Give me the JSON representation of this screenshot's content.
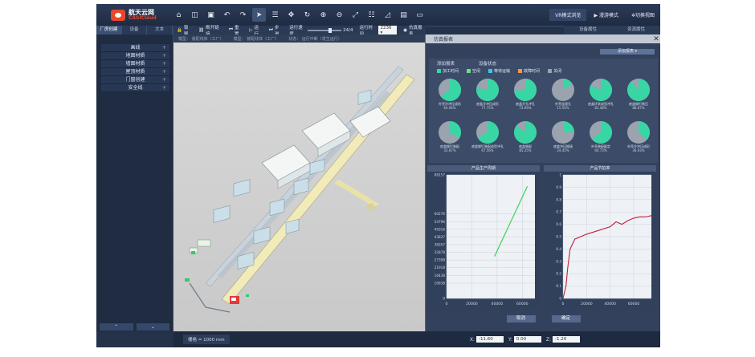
{
  "logo": {
    "name": "航天云网",
    "sub": "CASICloud"
  },
  "toolbar": {
    "icons": [
      "home-icon",
      "cube-icon",
      "save-icon",
      "undo-icon",
      "redo-icon",
      "cursor-icon",
      "list-icon",
      "move-icon",
      "rotate-icon",
      "zoom-in-icon",
      "zoom-out-icon",
      "fit-icon",
      "align-icon",
      "measure-icon",
      "layers-icon",
      "screen-icon"
    ],
    "vr_mode": "VR模式浏览",
    "roam_mode": "▶ 漫游模式",
    "switch_view": "✲切换视图"
  },
  "tabs_right": {
    "device_props": "设备属性",
    "resource_props": "资源属性"
  },
  "left_panel": {
    "tabs": [
      "厂房创建",
      "设备",
      "文本"
    ],
    "items": [
      "画线",
      "地面材质",
      "墙面材质",
      "屋顶材质",
      "门窗创建",
      "安全线"
    ],
    "nav_up": "⌃",
    "nav_down": "⌄"
  },
  "opbar": {
    "lock": "锁屏",
    "link": "断开链接",
    "reset": "重置",
    "run": "运行",
    "step": "步进",
    "speed_label": "运行速度",
    "speed_value": "24/4",
    "run_time_label": "运行时间",
    "run_time_value": "2236",
    "sim_report": "仿真报表",
    "speed_fraction": 0.62
  },
  "info": {
    "line1": "模型：  装配线体（工厂）",
    "line2": "模型：  装配线体（工厂）",
    "line3": "状态：  运行中断（发生运行）"
  },
  "status": {
    "grid": "栅格 = 1000 mm",
    "x_label": "X:",
    "x_value": "-11.60",
    "y_label": "Y:",
    "y_value": "0.00",
    "z_label": "Z:",
    "z_value": "-1.20"
  },
  "dialog": {
    "title": "仿真报表",
    "add_report": "添加报表",
    "sections": [
      "添加报表",
      "设备状态"
    ],
    "legend": [
      {
        "label": "加工时间",
        "color": "#38d6a4"
      },
      {
        "label": "空闲",
        "color": "#6fdc8c"
      },
      {
        "label": "等待运输",
        "color": "#3fc3e6"
      },
      {
        "label": "故障时间",
        "color": "#f09a4a"
      },
      {
        "label": "关闭",
        "color": "#9aa3ae"
      }
    ],
    "pies": [
      {
        "label": "外壳冷冲压成形",
        "pct": "64.94%",
        "value": 0.6494
      },
      {
        "label": "底盖冷冲压成形",
        "pct": "77.75%",
        "value": 0.7775
      },
      {
        "label": "底盖开孔冲孔",
        "pct": "73.69%",
        "value": 0.7369
      },
      {
        "label": "外壳连接孔",
        "pct": "15.50%",
        "value": 0.155
      },
      {
        "label": "底盖环状成型冲孔",
        "pct": "81.48%",
        "value": 0.8148
      },
      {
        "label": "底盖铆钉装压",
        "pct": "88.87%",
        "value": 0.8887
      },
      {
        "label": "底盖铆钉装配",
        "pct": "33.87%",
        "value": 0.3387
      },
      {
        "label": "底盖铆钉装配成型冲孔",
        "pct": "67.56%",
        "value": 0.6756
      },
      {
        "label": "底盖装配",
        "pct": "85.25%",
        "value": 0.8525
      },
      {
        "label": "底盖冲压铆接",
        "pct": "24.45%",
        "value": 0.2445
      },
      {
        "label": "外壳装配配定",
        "pct": "64.73%",
        "value": 0.6473
      },
      {
        "label": "外壳冷冲压成形",
        "pct": "36.93%",
        "value": 0.3693
      }
    ],
    "cancel": "取消",
    "confirm": "确定"
  },
  "chart_data": [
    {
      "type": "line",
      "title": "产品生产周期",
      "x": [
        38000,
        64000
      ],
      "series": [
        {
          "values": [
            30000,
            80000
          ]
        }
      ],
      "ylim": [
        0,
        88157
      ],
      "xlim": [
        0,
        70000
      ],
      "yticks": [
        0,
        10938,
        16438,
        21918,
        27398,
        32878,
        38357,
        43837,
        49316,
        54796,
        60276,
        88157
      ],
      "xticks": [
        0,
        20000,
        40000,
        60000
      ],
      "color": "#2ed14a"
    },
    {
      "type": "line",
      "title": "产品节拍率",
      "x": [
        0,
        2500,
        4000,
        6000,
        10000,
        20000,
        30000,
        40000,
        45000,
        50000,
        55000,
        60000,
        65000,
        70000,
        75000
      ],
      "series": [
        {
          "values": [
            0.0,
            0.1,
            0.25,
            0.4,
            0.48,
            0.52,
            0.55,
            0.58,
            0.62,
            0.6,
            0.63,
            0.65,
            0.66,
            0.66,
            0.67
          ]
        }
      ],
      "ylim": [
        0,
        1.0
      ],
      "xlim": [
        0,
        75000
      ],
      "yticks": [
        0,
        0.1,
        0.2,
        0.3,
        0.4,
        0.5,
        0.6,
        0.7,
        0.8,
        0.9,
        1.0
      ],
      "xticks": [
        0,
        20000,
        40000,
        60000
      ],
      "color": "#c0203a"
    }
  ]
}
